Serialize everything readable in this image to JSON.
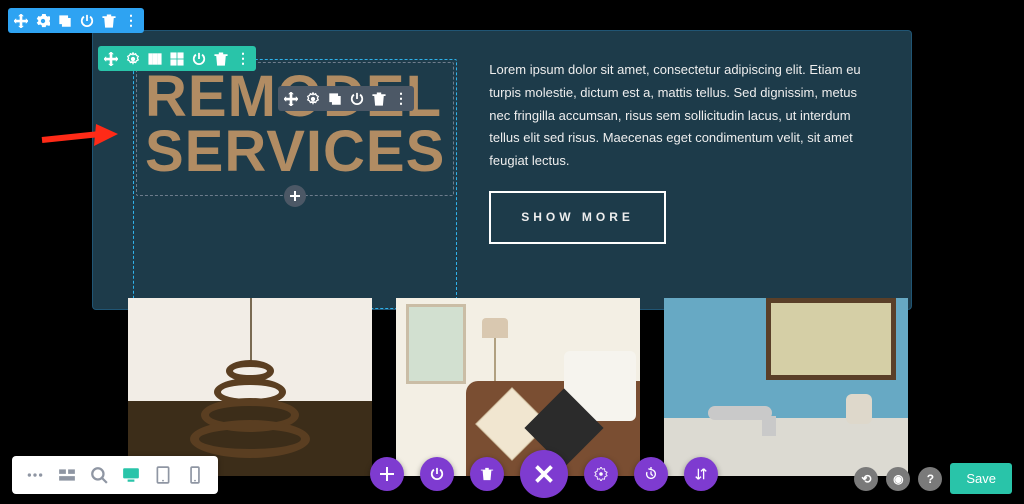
{
  "toolbar_blue": {
    "icons": [
      "move",
      "gear",
      "duplicate",
      "power",
      "trash",
      "more"
    ]
  },
  "toolbar_teal": {
    "icons": [
      "move",
      "gear",
      "columns",
      "grid",
      "power",
      "trash",
      "more"
    ]
  },
  "toolbar_gray": {
    "icons": [
      "move",
      "gear",
      "duplicate",
      "power",
      "trash",
      "more"
    ]
  },
  "heading": {
    "line1": "REMODEL",
    "line2": "SERVICES"
  },
  "body_text": "Lorem ipsum dolor sit amet, consectetur adipiscing elit. Etiam eu turpis molestie, dictum est a, mattis tellus. Sed dignissim, metus nec fringilla accumsan, risus sem sollicitudin lacus, ut interdum tellus elit sed risus. Maecenas eget condimentum velit, sit amet feugiat lectus.",
  "cta_label": "SHOW MORE",
  "bottombar_left": {
    "icons": [
      "more",
      "wireframe",
      "zoom",
      "desktop",
      "tablet",
      "phone"
    ],
    "active_index": 3
  },
  "purple_buttons": [
    "plus",
    "power",
    "trash",
    "close",
    "gear",
    "history",
    "sort"
  ],
  "bottombar_right": {
    "history": "⟲",
    "eye": "◉",
    "help": "?",
    "save_label": "Save"
  }
}
